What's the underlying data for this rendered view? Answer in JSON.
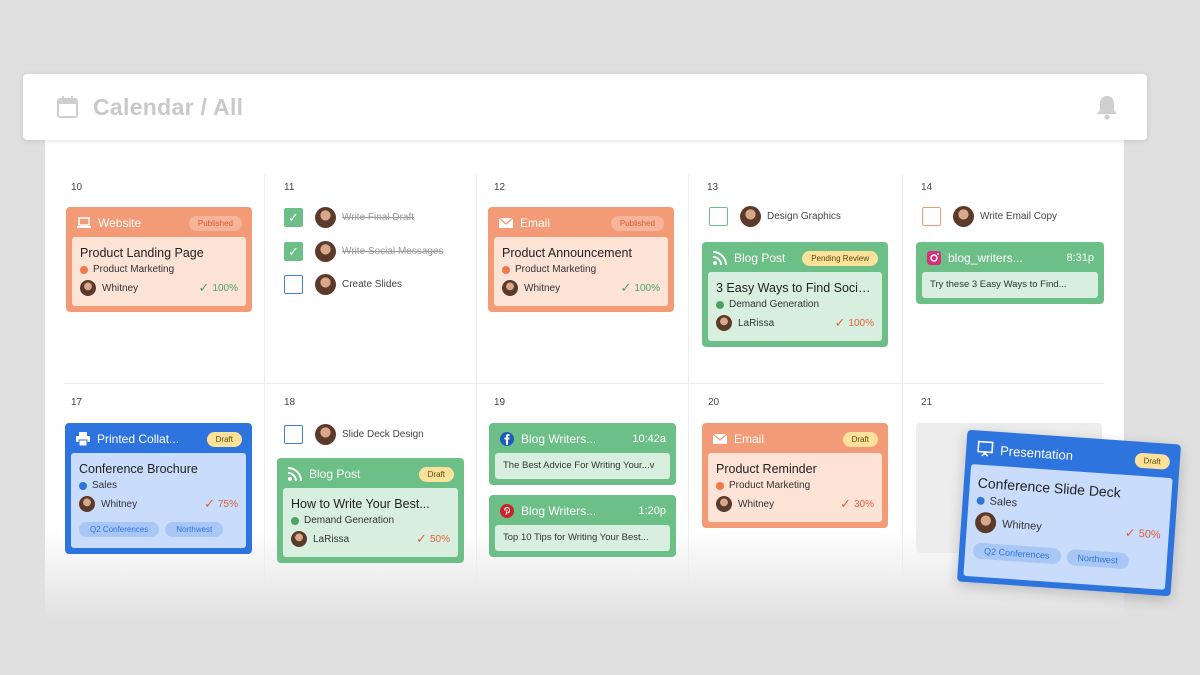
{
  "header": {
    "title": "Calendar / All",
    "calendar_icon": "calendar-icon",
    "bell_icon": "bell-icon"
  },
  "days": [
    "10",
    "11",
    "12",
    "13",
    "14",
    "17",
    "18",
    "19",
    "20",
    "21"
  ],
  "colors": {
    "orange": "#f39a76",
    "green": "#6cbf86",
    "blue": "#2e74de"
  },
  "cards": {
    "website": {
      "type": "Website",
      "status": "Published",
      "title": "Product Landing Page",
      "category": "Product Marketing",
      "owner": "Whitney",
      "progress": "100%"
    },
    "email1": {
      "type": "Email",
      "status": "Published",
      "title": "Product Announcement",
      "category": "Product Marketing",
      "owner": "Whitney",
      "progress": "100%"
    },
    "blogpost1": {
      "type": "Blog Post",
      "status": "Pending Review",
      "title": "3 Easy Ways to Find Social...",
      "category": "Demand Generation",
      "owner": "LaRissa",
      "progress": "100%"
    },
    "instagram": {
      "type": "blog_writers...",
      "time": "8:31p",
      "snippet": "Try these 3 Easy Ways to Find..."
    },
    "printed": {
      "type": "Printed Collat...",
      "status": "Draft",
      "title": "Conference Brochure",
      "category": "Sales",
      "owner": "Whitney",
      "progress": "75%",
      "tags": [
        "Q2 Conferences",
        "Northwest"
      ]
    },
    "blogpost2": {
      "type": "Blog Post",
      "status": "Draft",
      "title": "How to Write Your Best...",
      "category": "Demand Generation",
      "owner": "LaRissa",
      "progress": "50%"
    },
    "facebook": {
      "type": "Blog Writers...",
      "time": "10:42a",
      "snippet": "The Best Advice For Writing Your...v"
    },
    "pinterest": {
      "type": "Blog Writers...",
      "time": "1:20p",
      "snippet": "Top 10 Tips for Writing Your Best..."
    },
    "email2": {
      "type": "Email",
      "status": "Draft",
      "title": "Product Reminder",
      "category": "Product Marketing",
      "owner": "Whitney",
      "progress": "30%"
    },
    "presentation": {
      "type": "Presentation",
      "status": "Draft",
      "title": "Conference Slide Deck",
      "category": "Sales",
      "owner": "Whitney",
      "progress": "50%",
      "tags": [
        "Q2 Conferences",
        "Northwest"
      ]
    }
  },
  "tasks": {
    "t1": "Write Final Draft",
    "t2": "Write Social Messages",
    "t3": "Create Slides",
    "t4": "Design Graphics",
    "t5": "Write Email Copy",
    "t6": "Slide Deck Design"
  }
}
